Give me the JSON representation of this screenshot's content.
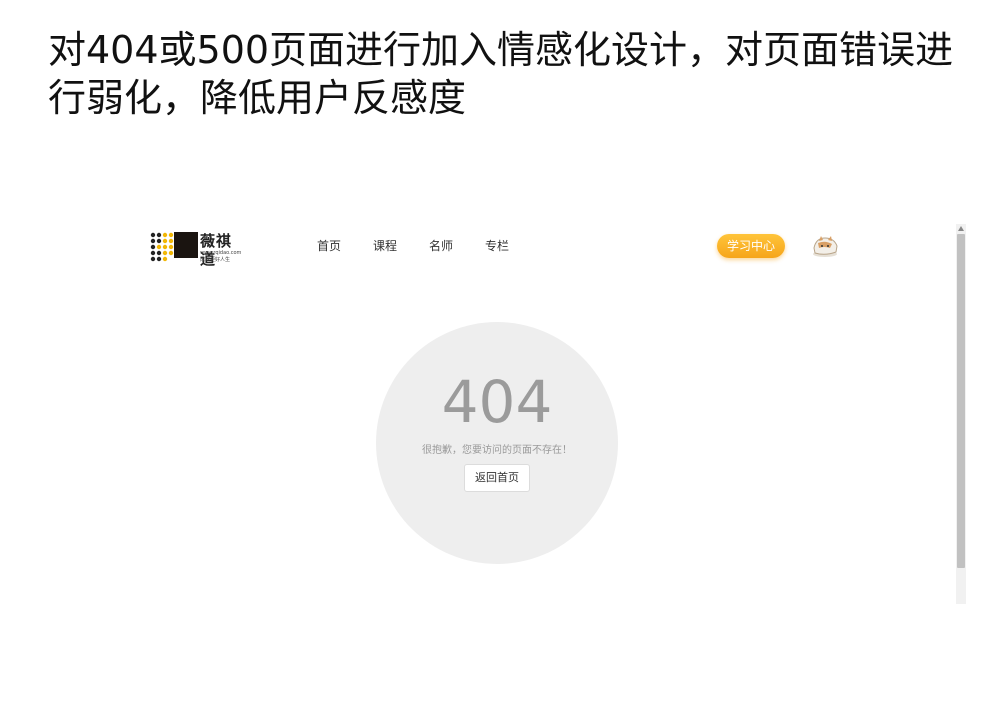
{
  "slide": {
    "title": "对404或500页面进行加入情感化设计，对页面错误进行弱化，降低用户反感度"
  },
  "site": {
    "logo": {
      "name": "薇祺道",
      "url": "www.rqidao.com",
      "slogan": "成就更好人生",
      "colors": {
        "dots": "#222222",
        "accent": "#f2b705",
        "block": "#1a1410"
      }
    },
    "nav": [
      {
        "label": "首页"
      },
      {
        "label": "课程"
      },
      {
        "label": "名师"
      },
      {
        "label": "专栏"
      }
    ],
    "study_button": {
      "label": "学习中心",
      "color": "#f6a51a"
    },
    "avatar_icon": "cat-avatar-icon"
  },
  "error_page": {
    "code": "404",
    "message": "很抱歉，您要访问的页面不存在！",
    "home_button": "返回首页",
    "circle_color": "#eeeeee"
  }
}
